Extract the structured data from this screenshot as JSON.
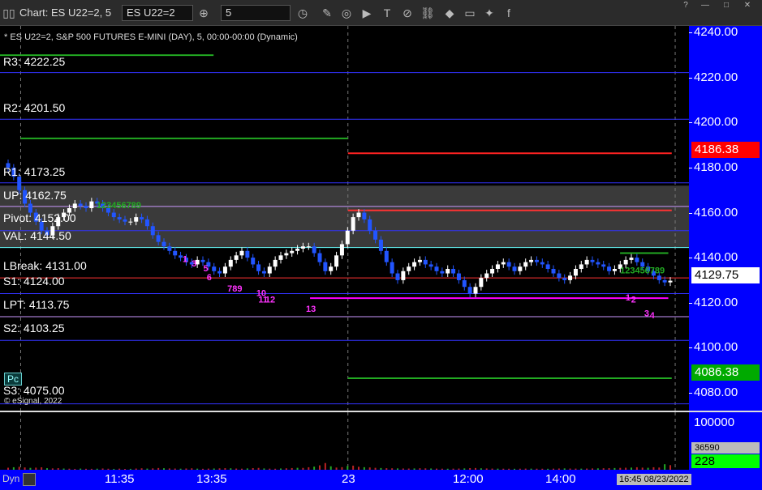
{
  "toolbar": {
    "window_title": "Chart: ES U22=2, 5",
    "symbol_value": "ES U22=2",
    "interval_value": "5",
    "win_help": "?",
    "win_min": "—",
    "win_max": "□",
    "win_close": "✕"
  },
  "chart_info": {
    "subtitle": "* ES U22=2, S&P 500 FUTURES E-MINI (DAY), 5, 00:00-00:00 (Dynamic)",
    "copyright": "© eSignal, 2022",
    "pc_badge": "Pc",
    "dyn_label": "Dyn"
  },
  "levels": {
    "r3": "R3: 4222.25",
    "r2": "R2: 4201.50",
    "r1": "R1: 4173.25",
    "up": "UP: 4162.75",
    "pivot": "Pivot: 4152.00",
    "val": "VAL: 4144.50",
    "lbreak": "LBreak: 4131.00",
    "s1": "S1: 4124.00",
    "lpt": "LPT: 4113.75",
    "s2": "S2: 4103.25",
    "s3": "S3: 4075.00"
  },
  "price_axis": {
    "ticks": [
      "4240.00",
      "4220.00",
      "4200.00",
      "4180.00",
      "4160.00",
      "4140.00",
      "4120.00",
      "4100.00",
      "4080.00"
    ],
    "tag_high": "4186.38",
    "tag_last": "4129.75",
    "tag_low": "4086.38",
    "vol_tick": "100000",
    "vol_last": "36590",
    "vol_count": "228",
    "colors": {
      "high": "#ff0000",
      "last": "#ffffff",
      "low": "#00cc00",
      "count": "#00ff00"
    }
  },
  "time_axis": {
    "labels": [
      "11:35",
      "13:35",
      "23",
      "12:00",
      "14:00"
    ],
    "timestamp": "16:45 08/23/2022"
  },
  "chart_data": {
    "type": "candlestick",
    "ylim": [
      4072,
      4243
    ],
    "volume_ylim": [
      0,
      120000
    ],
    "horizontal_levels": [
      {
        "value": 4222.25,
        "color": "#3333ff"
      },
      {
        "value": 4201.5,
        "color": "#3333ff"
      },
      {
        "value": 4173.25,
        "color": "#3333ff"
      },
      {
        "value": 4162.75,
        "color": "#cc99ff"
      },
      {
        "value": 4152.0,
        "color": "#3333ff"
      },
      {
        "value": 4144.5,
        "color": "#66ffff"
      },
      {
        "value": 4131.0,
        "color": "#ff3333"
      },
      {
        "value": 4124.0,
        "color": "#3333ff"
      },
      {
        "value": 4113.75,
        "color": "#cc99ff"
      },
      {
        "value": 4103.25,
        "color": "#3333ff"
      },
      {
        "value": 4075.0,
        "color": "#3333ff"
      }
    ],
    "value_area": {
      "low": 4144.5,
      "high": 4172.0
    },
    "prior_levels": [
      {
        "value": 4230.0,
        "color": "#22aa22",
        "from": 0.0,
        "to": 0.31
      },
      {
        "value": 4193.0,
        "color": "#22aa22",
        "from": 0.03,
        "to": 0.505
      },
      {
        "value": 4186.38,
        "color": "#ff2222",
        "from": 0.505,
        "to": 0.975
      },
      {
        "value": 4161.0,
        "color": "#ff3333",
        "from": 0.505,
        "to": 0.975
      },
      {
        "value": 4086.38,
        "color": "#22aa22",
        "from": 0.505,
        "to": 0.975
      },
      {
        "value": 4142.0,
        "color": "#22aa22",
        "from": 0.9,
        "to": 0.97
      },
      {
        "value": 4122.0,
        "color": "#ff00ff",
        "from": 0.45,
        "to": 0.97
      }
    ],
    "session_dividers": [
      0.03,
      0.505,
      0.98
    ],
    "closes": [
      4180,
      4176,
      4170,
      4164,
      4160,
      4156,
      4152,
      4150,
      4154,
      4158,
      4160,
      4162,
      4164,
      4163,
      4162,
      4165,
      4164,
      4162,
      4160,
      4158,
      4157,
      4156,
      4156,
      4158,
      4157,
      4154,
      4150,
      4147,
      4145,
      4143,
      4141,
      4140,
      4138,
      4137,
      4139,
      4138,
      4136,
      4134,
      4133,
      4136,
      4139,
      4141,
      4143,
      4140,
      4137,
      4134,
      4133,
      4136,
      4139,
      4141,
      4142,
      4143,
      4144,
      4145,
      4145,
      4142,
      4138,
      4134,
      4136,
      4141,
      4146,
      4152,
      4158,
      4160,
      4157,
      4152,
      4148,
      4143,
      4138,
      4133,
      4130,
      4134,
      4136,
      4138,
      4139,
      4137,
      4136,
      4134,
      4133,
      4135,
      4133,
      4130,
      4127,
      4124,
      4127,
      4131,
      4133,
      4135,
      4137,
      4138,
      4136,
      4134,
      4136,
      4138,
      4139,
      4138,
      4137,
      4135,
      4133,
      4131,
      4130,
      4132,
      4135,
      4137,
      4139,
      4138,
      4137,
      4136,
      4134,
      4135,
      4137,
      4139,
      4140,
      4138,
      4136,
      4134,
      4132,
      4130,
      4129,
      4129.75
    ],
    "annotations": [
      {
        "text": "1",
        "value": 4138,
        "x": 0.265,
        "color": "#ff33ff"
      },
      {
        "text": "3",
        "value": 4136,
        "x": 0.278,
        "color": "#ff33ff"
      },
      {
        "text": "5",
        "value": 4134,
        "x": 0.295,
        "color": "#ff33ff"
      },
      {
        "text": "6",
        "value": 4130,
        "x": 0.3,
        "color": "#ff33ff"
      },
      {
        "text": "789",
        "value": 4125,
        "x": 0.33,
        "color": "#ff33ff"
      },
      {
        "text": "10",
        "value": 4123,
        "x": 0.372,
        "color": "#ff33ff"
      },
      {
        "text": "11",
        "value": 4120,
        "x": 0.375,
        "color": "#ff33ff"
      },
      {
        "text": "12",
        "value": 4120,
        "x": 0.385,
        "color": "#ff33ff"
      },
      {
        "text": "13",
        "value": 4116,
        "x": 0.444,
        "color": "#ff33ff"
      },
      {
        "text": "1",
        "value": 4121,
        "x": 0.908,
        "color": "#ff33ff"
      },
      {
        "text": "2",
        "value": 4120,
        "x": 0.916,
        "color": "#ff33ff"
      },
      {
        "text": "3",
        "value": 4114,
        "x": 0.935,
        "color": "#ff33ff"
      },
      {
        "text": "4",
        "value": 4113,
        "x": 0.943,
        "color": "#ff33ff"
      },
      {
        "text": "123456789",
        "value": 4162,
        "x": 0.14,
        "color": "#22aa22"
      },
      {
        "text": "123456789",
        "value": 4133,
        "x": 0.9,
        "color": "#22aa22"
      }
    ],
    "volume": [
      4200,
      5200,
      6100,
      4800,
      3900,
      4400,
      5100,
      3200,
      2800,
      3300,
      2500,
      2200,
      1800,
      2400,
      2000,
      1900,
      2200,
      2600,
      2100,
      1800,
      2300,
      1700,
      1900,
      2500,
      3000,
      2400,
      2800,
      3600,
      3100,
      2700,
      2500,
      2200,
      2600,
      3000,
      2300,
      2000,
      2400,
      2600,
      2900,
      3300,
      3000,
      2500,
      2200,
      2800,
      3400,
      3800,
      2700,
      2300,
      2100,
      2600,
      3000,
      3500,
      4000,
      3800,
      5200,
      6500,
      9200,
      14000,
      7200,
      4600,
      5400,
      7800,
      8600,
      6200,
      5300,
      4800,
      4000,
      3600,
      3200,
      3000,
      2800,
      2600,
      2500,
      2700,
      3100,
      2900,
      2600,
      2400,
      2200,
      2100,
      2300,
      2500,
      2800,
      3400,
      3600,
      3000,
      2700,
      2400,
      2300,
      2200,
      2100,
      2000,
      2200,
      2400,
      2300,
      2200,
      2100,
      2000,
      2300,
      2600,
      2800,
      2500,
      2400,
      2300,
      2500,
      2700,
      2900,
      3100,
      3300,
      3600,
      3900,
      4200,
      4500,
      5200,
      4400,
      4100,
      5200,
      4600,
      11500,
      9600
    ]
  }
}
